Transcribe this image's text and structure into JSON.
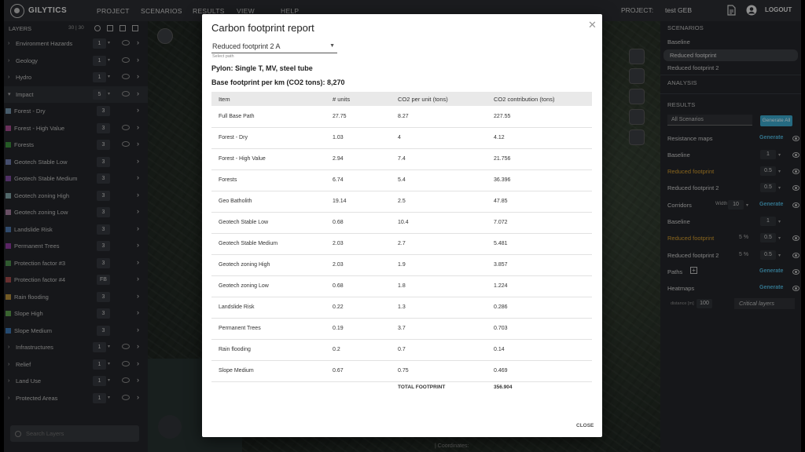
{
  "topbar": {
    "logo": "GILYTICS",
    "nav": [
      "PROJECT",
      "SCENARIOS",
      "RESULTS",
      "VIEW",
      "HELP"
    ],
    "project_label": "PROJECT:",
    "project_name": "test GEB",
    "logout": "LOGOUT"
  },
  "layers": {
    "title": "LAYERS",
    "count": "30 | 30",
    "search_placeholder": "Search Layers",
    "groups_top": [
      {
        "name": "Environment Hazards",
        "value": "1"
      },
      {
        "name": "Geology",
        "value": "1"
      },
      {
        "name": "Hydro",
        "value": "1"
      }
    ],
    "impact": {
      "name": "Impact",
      "value": "5"
    },
    "sub": [
      {
        "name": "Forest - Dry",
        "value": "3",
        "color": "#6f8fa6"
      },
      {
        "name": "Forest - High Value",
        "value": "3",
        "color": "#a14a8a"
      },
      {
        "name": "Forests",
        "value": "3",
        "color": "#3a8a3a"
      },
      {
        "name": "Geotech Stable Low",
        "value": "3",
        "color": "#6a78a8"
      },
      {
        "name": "Geotech Stable Medium",
        "value": "3",
        "color": "#7a4a9a"
      },
      {
        "name": "Geotech zoning High",
        "value": "3",
        "color": "#7fa0a3"
      },
      {
        "name": "Geotech zoning Low",
        "value": "3",
        "color": "#a07a9a"
      },
      {
        "name": "Landslide Risk",
        "value": "3",
        "color": "#4a74a8"
      },
      {
        "name": "Permanent Trees",
        "value": "3",
        "color": "#8a3a9a"
      },
      {
        "name": "Protection factor #3",
        "value": "3",
        "color": "#4a8a4a"
      },
      {
        "name": "Protection factor #4",
        "value": "FB",
        "color": "#a04a4a"
      },
      {
        "name": "Rain flooding",
        "value": "3",
        "color": "#b08a3a"
      },
      {
        "name": "Slope High",
        "value": "3",
        "color": "#5a9a4a"
      },
      {
        "name": "Slope Medium",
        "value": "3",
        "color": "#3a74b0"
      }
    ],
    "groups_bottom": [
      {
        "name": "Infrastructures",
        "value": "1"
      },
      {
        "name": "Relief",
        "value": "1"
      },
      {
        "name": "Land Use",
        "value": "1"
      },
      {
        "name": "Protected Areas",
        "value": "1"
      }
    ]
  },
  "map": {
    "coordinates_label": "| Coordinates:"
  },
  "right": {
    "scenarios_title": "SCENARIOS",
    "scenarios": [
      "Baseline",
      "Reduced footprint",
      "Reduced footprint 2"
    ],
    "analysis": "ANALYSIS",
    "results": "RESULTS",
    "all_scenarios": "All Scenarios",
    "generate_all": "Generate All",
    "resistance_maps": "Resistance maps",
    "generate": "Generate",
    "rm_rows": [
      {
        "name": "Baseline",
        "value": "1"
      },
      {
        "name": "Reduced footprint",
        "value": "0.5"
      },
      {
        "name": "Reduced footprint 2",
        "value": "0.5"
      }
    ],
    "corridors": "Corridors",
    "width_label": "Width",
    "width_value": "10",
    "cor_rows": [
      {
        "name": "Baseline",
        "pct": "",
        "value": "1"
      },
      {
        "name": "Reduced footprint",
        "pct": "5 %",
        "value": "0.5"
      },
      {
        "name": "Reduced footprint 2",
        "pct": "5 %",
        "value": "0.5"
      }
    ],
    "paths": "Paths",
    "heatmaps": "Heatmaps",
    "distance_label": "distance [m]",
    "distance_value": "100",
    "critical_layers": "Critical layers"
  },
  "modal": {
    "title": "Carbon footprint report",
    "path_value": "Reduced footprint 2 A",
    "path_hint": "Select path",
    "pylon": "Pylon:  Single T, MV, steel tube",
    "base": "Base footprint per km (CO2 tons):  8,270",
    "columns": [
      "Item",
      "# units",
      "CO2 per unit (tons)",
      "CO2 contribution (tons)"
    ],
    "rows": [
      [
        "Full Base Path",
        "27.75",
        "8.27",
        "227.55"
      ],
      [
        "Forest - Dry",
        "1.03",
        "4",
        "4.12"
      ],
      [
        "Forest - High Value",
        "2.94",
        "7.4",
        "21.756"
      ],
      [
        "Forests",
        "6.74",
        "5.4",
        "36.396"
      ],
      [
        "Geo Batholith",
        "19.14",
        "2.5",
        "47.85"
      ],
      [
        "Geotech Stable Low",
        "0.68",
        "10.4",
        "7.072"
      ],
      [
        "Geotech Stable Medium",
        "2.03",
        "2.7",
        "5.481"
      ],
      [
        "Geotech zoning High",
        "2.03",
        "1.9",
        "3.857"
      ],
      [
        "Geotech zoning Low",
        "0.68",
        "1.8",
        "1.224"
      ],
      [
        "Landslide Risk",
        "0.22",
        "1.3",
        "0.286"
      ],
      [
        "Permanent Trees",
        "0.19",
        "3.7",
        "0.703"
      ],
      [
        "Rain flooding",
        "0.2",
        "0.7",
        "0.14"
      ],
      [
        "Slope Medium",
        "0.67",
        "0.75",
        "0.469"
      ]
    ],
    "total_label": "TOTAL FOOTPRINT",
    "total_value": "356.904",
    "close": "CLOSE"
  }
}
